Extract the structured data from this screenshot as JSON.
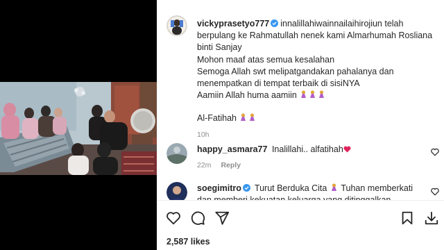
{
  "post": {
    "username": "vickyprasetyo777",
    "lines": [
      "innalillahiwainnailaihirojiun telah",
      "berpulang ke Rahmatullah nenek kami Almarhumah Rosliana",
      "binti Sanjay",
      "Mohon maaf atas semua kesalahan",
      "Semoga Allah swt melipatgandakan pahalanya dan",
      "menempatkan di tempat terbaik di sisiNYA",
      "Aamiin Allah huma aamiin"
    ],
    "closing": "Al-Fatihah",
    "time": "10h"
  },
  "comments": [
    {
      "username": "happy_asmara77",
      "text": "Inalillahi.. alfatihah",
      "time": "22m",
      "reply_label": "Reply"
    },
    {
      "username": "soegimitro",
      "text_line1": "Turut Berduka Cita",
      "text_line1b": "Tuhan memberkati",
      "text_line2": "dan memberi kekuatan keluarga yang ditinggalkan"
    }
  ],
  "likes": "2,587 likes",
  "icons": {
    "like": "heart-icon",
    "comment": "comment-icon",
    "share": "share-icon",
    "save": "bookmark-icon",
    "download": "download-icon",
    "verified": "verified-badge-icon",
    "emoji": "praying-hands-emoji",
    "heart_emoji": "red-heart-emoji"
  },
  "colors": {
    "verified": "#3897f0",
    "text": "#262626",
    "muted": "#8e8e8e",
    "heart": "#ed4956"
  }
}
